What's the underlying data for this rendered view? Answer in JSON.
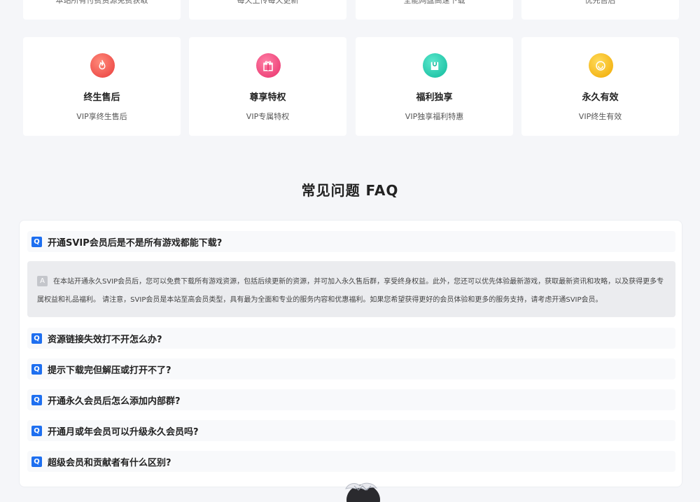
{
  "top_cards": [
    {
      "text": "本站所有付费资源免费获取"
    },
    {
      "text": "每天上传每天更新"
    },
    {
      "text": "全能网盘高速下载"
    },
    {
      "text": "优先售后"
    }
  ],
  "features": [
    {
      "icon": "flame-icon",
      "title": "终生售后",
      "subtitle": "VIP享终生售后",
      "color": "#f2544f"
    },
    {
      "icon": "gift-icon",
      "title": "尊享特权",
      "subtitle": "VIP专属特权",
      "color": "#f0457a"
    },
    {
      "icon": "bag-icon",
      "title": "福利独享",
      "subtitle": "VIP独享福利特惠",
      "color": "#22cfb3"
    },
    {
      "icon": "smile-icon",
      "title": "永久有效",
      "subtitle": "VIP终生有效",
      "color": "#f6bd1a"
    }
  ],
  "faq": {
    "heading": "常见问题 FAQ",
    "q_badge": "Q",
    "a_badge": "A",
    "items": [
      {
        "question": "开通SVIP会员后是不是所有游戏都能下载?"
      },
      {
        "question": "资源链接失效打不开怎么办?"
      },
      {
        "question": "提示下载完但解压或打开不了?"
      },
      {
        "question": "开通永久会员后怎么添加内部群?"
      },
      {
        "question": "开通月或年会员可以升级永久会员吗?"
      },
      {
        "question": "超级会员和贡献者有什么区别?"
      }
    ],
    "answer": "在本站开通永久SVIP会员后，您可以免费下载所有游戏资源，包括后续更新的资源，并可加入永久售后群，享受终身权益。此外，您还可以优先体验最新游戏，获取最新资讯和攻略，以及获得更多专属权益和礼品福利。 请注意，SVIP会员是本站至高会员类型，具有最为全面和专业的服务内容和优惠福利。如果您希望获得更好的会员体验和更多的服务支持，请考虑开通SVIP会员。"
  }
}
